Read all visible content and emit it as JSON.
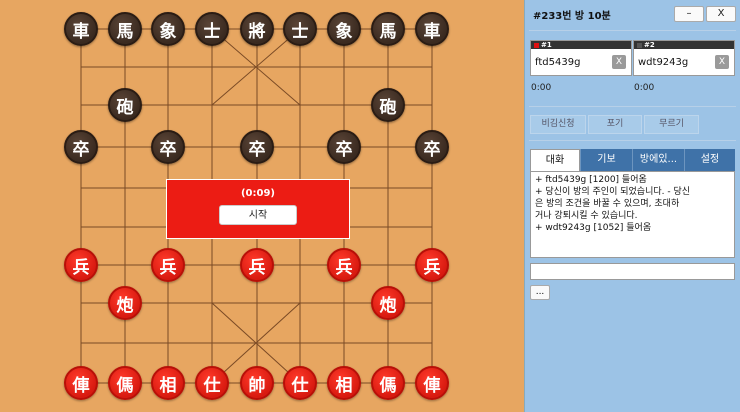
{
  "room": {
    "title": "#233번 방   10분"
  },
  "window": {
    "minimize_label": "–",
    "close_label": "X"
  },
  "board": {
    "black_pieces": [
      "車",
      "馬",
      "象",
      "士",
      "將",
      "士",
      "象",
      "馬",
      "車",
      "砲",
      "砲",
      "卒",
      "卒",
      "卒",
      "卒",
      "卒"
    ],
    "red_pieces": [
      "兵",
      "兵",
      "兵",
      "兵",
      "兵",
      "炮",
      "炮",
      "俥",
      "傌",
      "相",
      "仕",
      "帥",
      "仕",
      "相",
      "傌",
      "俥"
    ]
  },
  "overlay": {
    "timer": "(0:09)",
    "start_label": "시작"
  },
  "players": [
    {
      "slot": "#1",
      "name": "ftd5439g",
      "time": "0:00",
      "kick_label": "X",
      "color": "#e01010"
    },
    {
      "slot": "#2",
      "name": "wdt9243g",
      "time": "0:00",
      "kick_label": "X",
      "color": "#333333"
    }
  ],
  "actions": {
    "draw": "비김신청",
    "resign": "포기",
    "undo": "무르기"
  },
  "tabs": {
    "chat": "대화",
    "record": "기보",
    "room_info": "방에있...",
    "settings": "설정"
  },
  "chat": {
    "lines": [
      "+ ftd5439g [1200] 들어옴",
      "+ 당신이 방의 주인이 되었습니다. - 당신",
      "  은 방의 조건을 바꿀 수 있으며, 초대하",
      "  거나 강퇴시킬 수 있습니다.",
      "+ wdt9243g [1052] 들어옴"
    ]
  },
  "more_label": "..."
}
